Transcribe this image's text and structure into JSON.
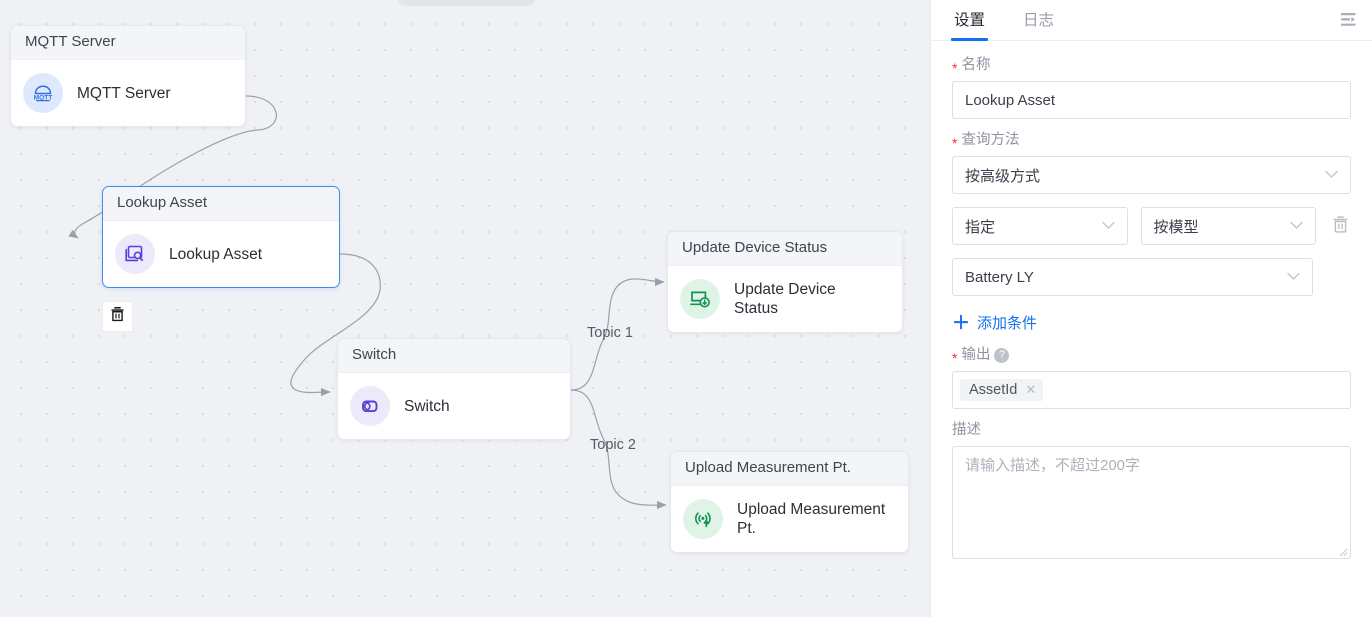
{
  "canvas": {
    "nodes": [
      {
        "id": "mqtt",
        "header": "MQTT Server",
        "label": "MQTT Server",
        "icon": "mqtt-icon"
      },
      {
        "id": "lookup",
        "header": "Lookup Asset",
        "label": "Lookup Asset",
        "icon": "lookup-asset-icon"
      },
      {
        "id": "switch",
        "header": "Switch",
        "label": "Switch",
        "icon": "switch-icon"
      },
      {
        "id": "update",
        "header": "Update Device Status",
        "label": "Update Device Status",
        "icon": "update-device-status-icon"
      },
      {
        "id": "upload",
        "header": "Upload Measurement Pt.",
        "label": "Upload Measurement Pt.",
        "icon": "upload-measurement-icon"
      }
    ],
    "edge_labels": [
      "Topic 1",
      "Topic 2"
    ],
    "delete_button_icon": "trash-icon"
  },
  "panel": {
    "tabs": [
      {
        "label": "设置",
        "active": true
      },
      {
        "label": "日志",
        "active": false
      }
    ],
    "collapse_icon": "menu-fold-icon",
    "name": {
      "label": "名称",
      "required": true,
      "value": "Lookup Asset"
    },
    "query_method": {
      "label": "查询方法",
      "required": true,
      "value": "按高级方式",
      "caret_icon": "chevron-down-icon"
    },
    "condition_row": {
      "operator_value": "指定",
      "field_value": "按模型",
      "delete_icon": "trash-icon"
    },
    "model": {
      "value": "Battery LY"
    },
    "add_condition": {
      "label": "添加条件",
      "icon": "plus-icon"
    },
    "output": {
      "label": "输出",
      "required": true,
      "help_icon": "question-circle-icon",
      "tags": [
        {
          "label": "AssetId",
          "remove_icon": "close-icon"
        }
      ]
    },
    "description": {
      "label": "描述",
      "placeholder": "请输入描述，不超过200字",
      "value": ""
    }
  },
  "colors": {
    "accent": "#1470ef",
    "selected_border": "#3d8bf2",
    "required_star": "#e8393c",
    "canvas_bg": "#eff1f5",
    "node_purple": "#5a3fd6",
    "node_green": "#119356",
    "node_blue": "#2f6fe0"
  }
}
